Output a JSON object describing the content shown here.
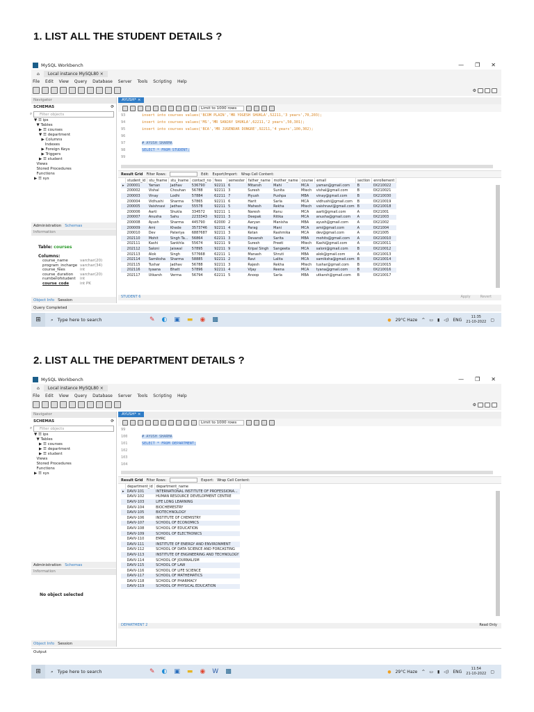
{
  "q1": {
    "heading": "1.  LIST ALL THE STUDENT DETAILS ?"
  },
  "q2": {
    "heading": "2.  LIST ALL THE DEPARTMENT DETAILS ?"
  },
  "app": {
    "title": "MySQL Workbench",
    "conn_tab": "Local instance MySQL80",
    "menu": [
      "File",
      "Edit",
      "View",
      "Query",
      "Database",
      "Server",
      "Tools",
      "Scripting",
      "Help"
    ],
    "navigator": "Navigator",
    "schemas": "SCHEMAS",
    "filter_placeholder": "Filter objects",
    "administration": "Administration",
    "schemas_tab": "Schemas",
    "information": "Information",
    "object_info": "Object Info",
    "session": "Session",
    "limit": "Limit to 1000 rows",
    "result_grid": "Result Grid",
    "filter_rows": "Filter Rows:",
    "edit": "Edit:",
    "export_import": "Export/Import:",
    "export": "Export:",
    "wrap": "Wrap Cell Content:",
    "search_placeholder": "Type here to search",
    "weather": "29°C  Haze",
    "lang": "ENG"
  },
  "w1": {
    "editor_tab": "AYUSH*",
    "tree": [
      "▼ ☰ ips",
      "  ▼ Tables",
      "    ▶ ☰ courses",
      "    ▼ ☰ department",
      "      ▶ Columns",
      "         Indexes",
      "      ▶ Foreign Keys",
      "      ▶ Triggers",
      "    ▶ ☰ student",
      "  Views",
      "  Stored Procedures",
      "  Functions",
      "▶ ☰ sys"
    ],
    "info_table_label": "Table:",
    "info_table": "courses",
    "columns_label": "Columns:",
    "columns": [
      [
        "course_name",
        "varchar(20)"
      ],
      [
        "program_incharge",
        "varchar(34)"
      ],
      [
        "course_fees",
        "int"
      ],
      [
        "course_duration",
        "varchar(20)"
      ],
      [
        "numberofstudent",
        "int"
      ],
      [
        "course_code",
        "int PK"
      ]
    ],
    "code": [
      {
        "n": "93",
        "t": "insert into courses values('BCOM PLAIN','MR YOGESH SHUKLA',52211,'3 years',70,203);"
      },
      {
        "n": "94",
        "t": "insert into courses values('MS','MR SANJAY SHUKLA',62211,'2 years',50,301);"
      },
      {
        "n": "95",
        "t": "insert into courses values('BCA','MR JUGENDAR DONGRE',92211,'4 years',100,302);"
      },
      {
        "n": "96",
        "t": ""
      },
      {
        "n": "97",
        "t": "# AYUSH SHARMA"
      },
      {
        "n": "98",
        "t": "SELECT * FROM STUDENT;"
      },
      {
        "n": "99",
        "t": ""
      }
    ],
    "headers": [
      "student_id",
      "stu_fname",
      "stu_lname",
      "contact_no",
      "fees",
      "semester",
      "father_name",
      "mother_name",
      "course",
      "email",
      "section",
      "enrollement"
    ],
    "rows": [
      [
        "200001",
        "Yaman",
        "Jadhav",
        "536790",
        "92211",
        "6",
        "Mitansh",
        "Mahi",
        "MCA",
        "yaman@gmail.com",
        "B",
        "0X210022"
      ],
      [
        "200002",
        "Vishal",
        "Chouhan",
        "56788",
        "92211",
        "3",
        "Suresh",
        "Sunita",
        "Mtech",
        "vishal@gmail.com",
        "B",
        "0X210021"
      ],
      [
        "200003",
        "Vinay",
        "Lodhi",
        "57884",
        "62211",
        "7",
        "Piyush",
        "Pushpa",
        "MBA",
        "vinay@gmail.com",
        "B",
        "0X210030"
      ],
      [
        "200004",
        "Vidhushi",
        "Sharma",
        "57865",
        "92211",
        "6",
        "Harit",
        "Sarla",
        "MCA",
        "vidhushi@gmail.com",
        "B",
        "0X210019"
      ],
      [
        "200005",
        "Vaishnavi",
        "Jadhav",
        "55578",
        "92211",
        "5",
        "Mahesh",
        "Rekha",
        "Mtech",
        "vaishnavi@gmail.com",
        "B",
        "0X210018"
      ],
      [
        "200006",
        "Aarti",
        "Shukla",
        "334572",
        "92211",
        "1",
        "Naresh",
        "Ranu",
        "MCA",
        "aarti@gmail.com",
        "A",
        "0X21001"
      ],
      [
        "200007",
        "Anusha",
        "Sahu",
        "2233343",
        "92211",
        "3",
        "Deepak",
        "Ritika",
        "MCA",
        "anusha@gmail.com",
        "A",
        "0X21003"
      ],
      [
        "200008",
        "Ayush",
        "Sharma",
        "445790",
        "62000",
        "2",
        "Aaryan",
        "Manisha",
        "MBA",
        "ayush@gmail.com",
        "A",
        "0X21002"
      ],
      [
        "200009",
        "Ami",
        "Khede",
        "3573746",
        "92211",
        "4",
        "Parag",
        "Mani",
        "MCA",
        "ami@gmail.com",
        "A",
        "0X21004"
      ],
      [
        "200010",
        "Dev",
        "Pateriya",
        "6887687",
        "92211",
        "3",
        "Ketan",
        "Rashmika",
        "MCA",
        "dev@gmail.com",
        "A",
        "0X21005"
      ],
      [
        "202110",
        "Mohit",
        "Singh Ta...",
        "56864",
        "62211",
        "3",
        "Devansh",
        "Sarita",
        "MBA",
        "mohits@gmail.com",
        "A",
        "0X210010"
      ],
      [
        "202111",
        "Kashi",
        "Sankhla",
        "55674",
        "92211",
        "9",
        "Suresh",
        "Preeti",
        "Mtech",
        "Kashi@gmail.com",
        "A",
        "0X210011"
      ],
      [
        "202112",
        "Saloni",
        "Jaiswal",
        "57895",
        "92211",
        "9",
        "Kripal Singh",
        "Sangeeta",
        "MCA",
        "saloni@gmail.com",
        "B",
        "0X210012"
      ],
      [
        "202113",
        "Alok",
        "Singh",
        "577668",
        "62211",
        "1",
        "Manash",
        "Shruti",
        "MBA",
        "alok@gmail.com",
        "A",
        "0X210013"
      ],
      [
        "202114",
        "Samiksha",
        "Sharma",
        "58885",
        "92211",
        "2",
        "Ravi",
        "Lalita",
        "MCA",
        "samiksha@gmail.com",
        "B",
        "0X210014"
      ],
      [
        "202115",
        "Tushar",
        "Jadhav",
        "56788",
        "92211",
        "3",
        "Rajesh",
        "Rekha",
        "Mtech",
        "tushar@gmail.com",
        "B",
        "0X210015"
      ],
      [
        "202116",
        "tyaana",
        "Bhatt",
        "57896",
        "92211",
        "4",
        "Vijay",
        "Reena",
        "MCA",
        "tyana@gmail.com",
        "B",
        "0X210016"
      ],
      [
        "202117",
        "Utkarsh",
        "Verma",
        "56794",
        "62211",
        "5",
        "Anoop",
        "Sarla",
        "MBA",
        "utkarsh@gmail.com",
        "B",
        "0X210017"
      ]
    ],
    "result_tab": "STUDENT 6",
    "apply": "Apply",
    "revert": "Revert",
    "status": "Query Completed",
    "time": "11:35",
    "date": "21-10-2022"
  },
  "w2": {
    "editor_tab": "AYUSH*",
    "tree": [
      "▼ ☰ ips",
      "  ▼ Tables",
      "    ▶ ☰ courses",
      "    ▶ ☰ department",
      "    ▶ ☰ student",
      "  Views",
      "  Stored Procedures",
      "  Functions",
      "▶ ☰ sys"
    ],
    "no_object": "No object selected",
    "code": [
      {
        "n": "99",
        "t": ""
      },
      {
        "n": "100",
        "t": "# AYUSH SHARMA"
      },
      {
        "n": "101",
        "t": "SELECT * FROM DEPARTMENT;"
      },
      {
        "n": "102",
        "t": ""
      },
      {
        "n": "103",
        "t": ""
      },
      {
        "n": "104",
        "t": ""
      }
    ],
    "headers": [
      "department_id",
      "department_name"
    ],
    "rows": [
      [
        "DAVV-101",
        "INTERNATIONAL INSTITUTE OF PROFESSIONA..."
      ],
      [
        "DAVV-102",
        "HUMAN RESOURCE DEVELOPMENT CENTRE"
      ],
      [
        "DAVV-103",
        "LIFE LONG LEARNING"
      ],
      [
        "DAVV-104",
        "BIOCHEMESTRY"
      ],
      [
        "DAVV-105",
        "BIOTECHNOLOGY"
      ],
      [
        "DAVV-106",
        "INSTITUTE OF CHEMISTRY"
      ],
      [
        "DAVV-107",
        "SCHOOL OF ECONOMICS"
      ],
      [
        "DAVV-108",
        "SCHOOL OF EDUCATION"
      ],
      [
        "DAVV-109",
        "SCHOOL OF ELECTRONICS"
      ],
      [
        "DAVV-110",
        "EMRC"
      ],
      [
        "DAVV-111",
        "INSTITUTE OF ENERGY AND ENVIRONMENT"
      ],
      [
        "DAVV-112",
        "SCHOOL OF DATA SCIENCE AND FORCASTING"
      ],
      [
        "DAVV-113",
        "INSTITUTE OF ENGINEERING AND TECHNOLOGY"
      ],
      [
        "DAVV-114",
        "SCHOOL OF JOURNALISM"
      ],
      [
        "DAVV-115",
        "SCHOOL OF LAW"
      ],
      [
        "DAVV-116",
        "SCHOOL OF LIFE SCIENCE"
      ],
      [
        "DAVV-117",
        "SCHOOL OF MATHEMATICS"
      ],
      [
        "DAVV-118",
        "SCHOOL OF PHARMACY"
      ],
      [
        "DAVV-119",
        "SCHOOL OF PHYSICAL EDUCATION"
      ]
    ],
    "result_tab": "DEPARTMENT 2",
    "read_only": "Read Only",
    "output": "Output",
    "time": "11:54",
    "date": "21-10-2022"
  }
}
